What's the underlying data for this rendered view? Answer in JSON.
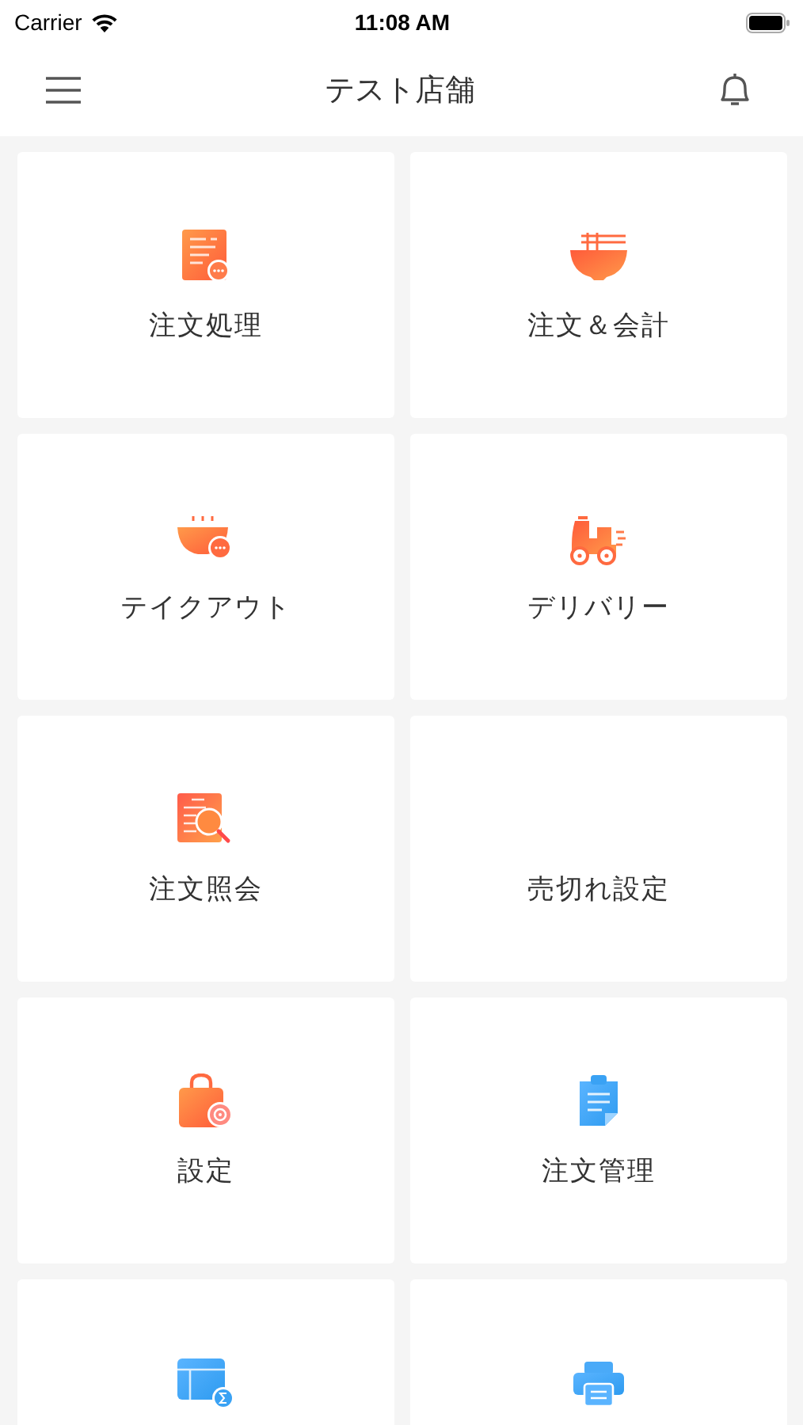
{
  "status_bar": {
    "carrier": "Carrier",
    "time": "11:08 AM"
  },
  "nav_bar": {
    "title": "テスト店舗"
  },
  "tiles": [
    {
      "kind": "receipt",
      "label": "注文処理"
    },
    {
      "kind": "bowl",
      "label": "注文＆会計"
    },
    {
      "kind": "takeout",
      "label": "テイクアウト"
    },
    {
      "kind": "scooter",
      "label": "デリバリー"
    },
    {
      "kind": "search",
      "label": "注文照会"
    },
    {
      "kind": "text",
      "label": "売切れ設定"
    },
    {
      "kind": "bag",
      "label": "設定"
    },
    {
      "kind": "clipboard",
      "label": "注文管理"
    },
    {
      "kind": "sheet"
    },
    {
      "kind": "printer"
    }
  ]
}
